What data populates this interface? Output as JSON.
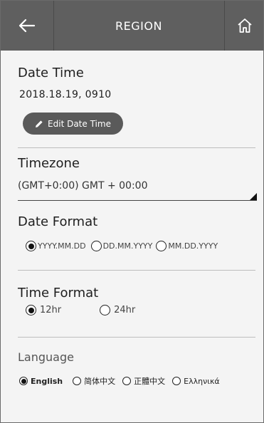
{
  "header": {
    "title": "REGION",
    "back_icon": "back-arrow-icon",
    "home_icon": "home-icon"
  },
  "datetime": {
    "title": "Date Time",
    "value": "2018.18.19, 0910",
    "edit_label": "Edit Date Time",
    "edit_icon": "pencil-icon"
  },
  "timezone": {
    "title": "Timezone",
    "value": "(GMT+0:00) GMT + 00:00"
  },
  "date_format": {
    "title": "Date Format",
    "options": [
      "YYYY.MM.DD",
      "DD.MM.YYYY",
      "MM.DD.YYYY"
    ],
    "selected": "YYYY.MM.DD"
  },
  "time_format": {
    "title": "Time Format",
    "options": [
      "12hr",
      "24hr"
    ],
    "selected": "12hr"
  },
  "language": {
    "title": "Language",
    "options": [
      "English",
      "简体中文",
      "正體中文",
      "Ελληνικά"
    ],
    "selected": "English"
  },
  "colors": {
    "header_bg": "#5f5f5f",
    "background": "#f4f4f4",
    "button_bg": "#5a5a5a"
  }
}
